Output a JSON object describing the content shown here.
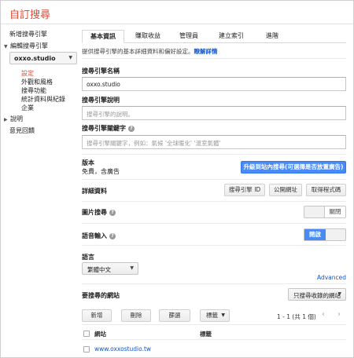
{
  "app": {
    "title": "自訂搜尋"
  },
  "sidebar": {
    "new_engine": "新增搜尋引擎",
    "edit_engine": "編輯搜尋引擎",
    "engine_select": "oxxo.studio",
    "sub_items": [
      {
        "label": "設定",
        "active": true
      },
      {
        "label": "外觀和風格"
      },
      {
        "label": "搜尋功能"
      },
      {
        "label": "統計資料與紀錄"
      },
      {
        "label": "企業"
      }
    ],
    "help": "說明",
    "feedback": "意見回饋"
  },
  "tabs": [
    {
      "label": "基本資訊",
      "active": true
    },
    {
      "label": "賺取收益"
    },
    {
      "label": "管理員"
    },
    {
      "label": "建立索引"
    },
    {
      "label": "進階"
    }
  ],
  "description": {
    "text": "提供搜尋引擎的基本詳細資料和偏好設定。",
    "link": "瞭解詳情"
  },
  "fields": {
    "name_label": "搜尋引擎名稱",
    "name_value": "oxxo.studio",
    "desc_label": "搜尋引擎說明",
    "desc_placeholder": "搜尋引擎的說明。",
    "keywords_label": "搜尋引擎關鍵字",
    "keywords_placeholder": "搜尋引擎關鍵字，例如：氣候 '全球暖化' '溫室氣體'"
  },
  "edition": {
    "label": "版本",
    "value": "免費，含廣告",
    "upgrade_button": "升級到站內搜尋(可選擇是否放置廣告)"
  },
  "details": {
    "label": "詳細資料",
    "buttons": [
      "搜尋引擎 ID",
      "公開網址",
      "取得程式碼"
    ]
  },
  "image_search": {
    "label": "圖片搜尋",
    "toggle_label": "關閉",
    "state": "off"
  },
  "voice_input": {
    "label": "語音輸入",
    "toggle_label": "開啟",
    "state": "on"
  },
  "language": {
    "label": "語言",
    "value": "繁體中文"
  },
  "advanced_link": "Advanced",
  "sites": {
    "label": "要搜尋的網站",
    "scope_select": "只搜尋收錄的網站",
    "actions": [
      "新增",
      "刪除",
      "篩選",
      "標籤"
    ],
    "pagination": "1 - 1 (共 1 個)",
    "columns": [
      "網站",
      "標籤"
    ],
    "rows": [
      {
        "site": "www.oxxostudio.tw",
        "label": ""
      }
    ]
  },
  "icons": {
    "prev": "chevron-left-icon",
    "next": "chevron-right-icon",
    "help": "help-icon",
    "dropdown": "chevron-down-icon"
  },
  "colors": {
    "brand": "#dd4b39",
    "primary": "#4a8af4",
    "link": "#1155cc"
  }
}
